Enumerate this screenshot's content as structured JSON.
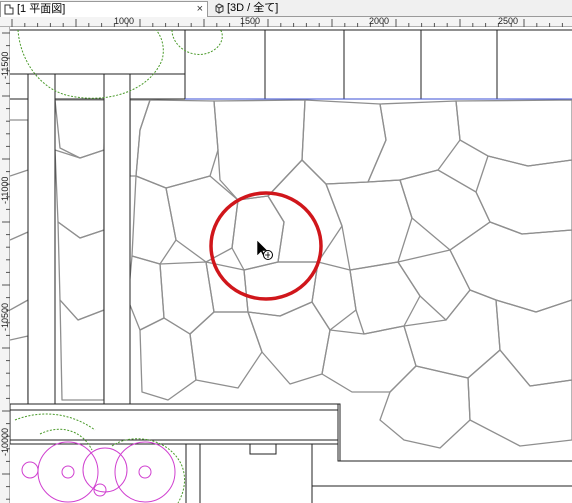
{
  "tabs": [
    {
      "label": "[1  平面図]",
      "close": "×",
      "active": true
    },
    {
      "label": "[3D / 全て]",
      "active": false
    }
  ],
  "ruler_h": {
    "labels": [
      "1000",
      "1500",
      "2000",
      "2500"
    ]
  },
  "ruler_v": {
    "labels": [
      "-11500",
      "-11000",
      "-10500",
      "-10000"
    ]
  },
  "colors": {
    "plant_green": "#4a9a2a",
    "circle_magenta": "#d040d0",
    "highlight_red": "#d0161b",
    "boundary_blue": "#3b4fd6"
  }
}
